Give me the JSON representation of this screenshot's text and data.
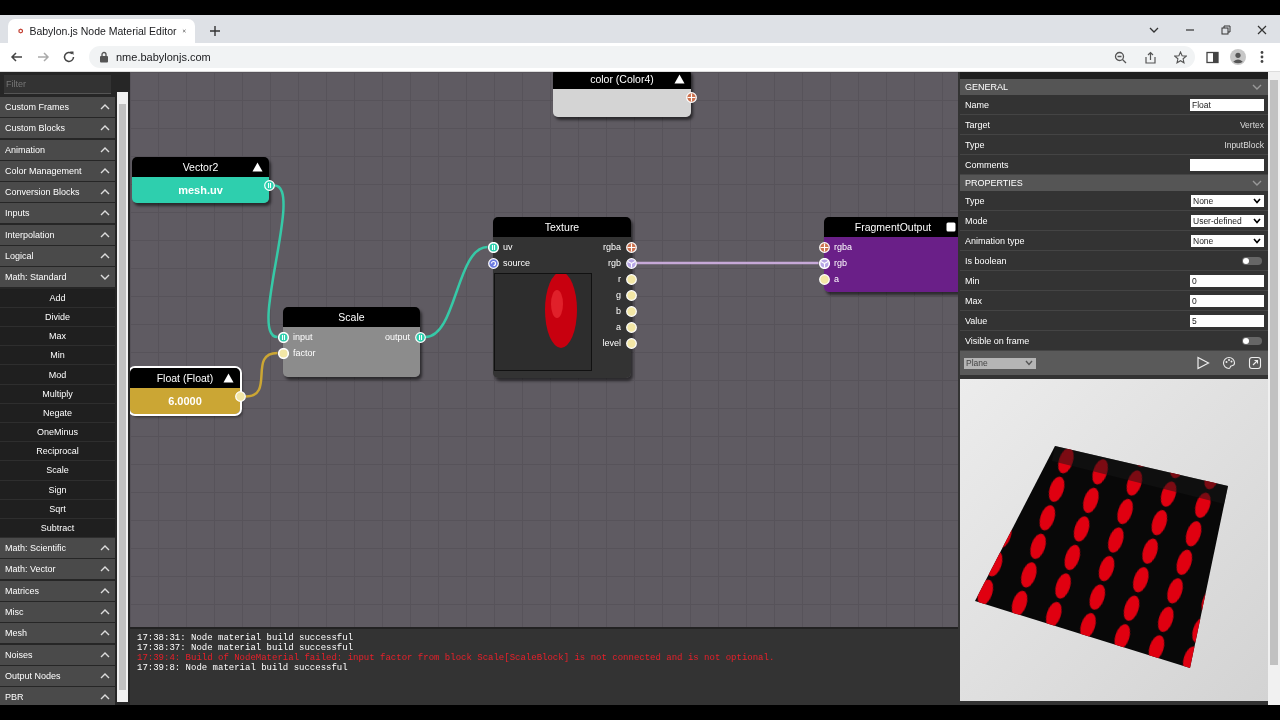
{
  "browser": {
    "tab_title": "Babylon.js Node Material Editor",
    "url": "nme.babylonjs.com"
  },
  "sidebar": {
    "filter_placeholder": "Filter",
    "categories": [
      {
        "label": "Custom Frames",
        "expanded": false
      },
      {
        "label": "Custom Blocks",
        "expanded": false
      },
      {
        "label": "Animation",
        "expanded": false
      },
      {
        "label": "Color Management",
        "expanded": false
      },
      {
        "label": "Conversion Blocks",
        "expanded": false
      },
      {
        "label": "Inputs",
        "expanded": false
      },
      {
        "label": "Interpolation",
        "expanded": false
      },
      {
        "label": "Logical",
        "expanded": false
      },
      {
        "label": "Math: Standard",
        "expanded": true,
        "children": [
          {
            "label": "Add"
          },
          {
            "label": "Divide"
          },
          {
            "label": "Max"
          },
          {
            "label": "Min"
          },
          {
            "label": "Mod"
          },
          {
            "label": "Multiply"
          },
          {
            "label": "Negate"
          },
          {
            "label": "OneMinus"
          },
          {
            "label": "Reciprocal"
          },
          {
            "label": "Scale"
          },
          {
            "label": "Sign"
          },
          {
            "label": "Sqrt"
          },
          {
            "label": "Subtract"
          }
        ]
      },
      {
        "label": "Math: Scientific",
        "expanded": false
      },
      {
        "label": "Math: Vector",
        "expanded": false
      },
      {
        "label": "Matrices",
        "expanded": false
      },
      {
        "label": "Misc",
        "expanded": false
      },
      {
        "label": "Mesh",
        "expanded": false
      },
      {
        "label": "Noises",
        "expanded": false
      },
      {
        "label": "Output Nodes",
        "expanded": false
      },
      {
        "label": "PBR",
        "expanded": false
      }
    ]
  },
  "graph": {
    "nodes": [
      {
        "title": "color (Color4)",
        "kind": "input",
        "selected": false,
        "color": "#d4d4d4",
        "outputs": [
          {
            "kind": "color4"
          }
        ]
      },
      {
        "title": "Vector2",
        "kind": "input",
        "selected": false,
        "color": "#2ecfae",
        "value": "mesh.uv",
        "outputs": [
          {
            "kind": "vector2"
          }
        ]
      },
      {
        "title": "Float (Float)",
        "kind": "input",
        "selected": true,
        "color": "#cba634",
        "value": "6.0000",
        "outputs": [
          {
            "kind": "float"
          }
        ]
      },
      {
        "title": "Scale",
        "kind": "block",
        "selected": false,
        "color": "#8c8c8c",
        "inputs": [
          {
            "label": "input",
            "kind": "vector2",
            "connected": true
          },
          {
            "label": "factor",
            "kind": "float",
            "connected": true
          }
        ],
        "outputs": [
          {
            "label": "output",
            "kind": "vector2"
          }
        ]
      },
      {
        "title": "Texture",
        "kind": "texture",
        "selected": false,
        "color": "#333333",
        "inputs": [
          {
            "label": "uv",
            "kind": "vector2",
            "connected": true
          },
          {
            "label": "source",
            "kind": "texture",
            "connected": false
          }
        ],
        "outputs": [
          {
            "label": "rgba",
            "kind": "color4"
          },
          {
            "label": "rgb",
            "kind": "color3"
          },
          {
            "label": "r",
            "kind": "float"
          },
          {
            "label": "g",
            "kind": "float"
          },
          {
            "label": "b",
            "kind": "float"
          },
          {
            "label": "a",
            "kind": "float"
          },
          {
            "label": "level",
            "kind": "float"
          }
        ]
      },
      {
        "title": "FragmentOutput",
        "kind": "output",
        "selected": false,
        "color": "#6a1f88",
        "inputs": [
          {
            "label": "rgba",
            "kind": "color4",
            "connected": false
          },
          {
            "label": "rgb",
            "kind": "color3",
            "connected": true
          },
          {
            "label": "a",
            "kind": "float",
            "connected": false
          }
        ]
      }
    ]
  },
  "log": [
    {
      "text": "17:38:31: Node material build successful",
      "kind": "info"
    },
    {
      "text": "17:38:37: Node material build successful",
      "kind": "info"
    },
    {
      "text": "17:39:4: Build of NodeMaterial failed: input factor from block Scale[ScaleBlock] is not connected and is not optional.",
      "kind": "error"
    },
    {
      "text": "17:39:8: Node material build successful",
      "kind": "info"
    }
  ],
  "properties": {
    "sections": [
      {
        "title": "GENERAL",
        "expanded": true,
        "rows": [
          {
            "label": "Name",
            "kind": "input",
            "value": "Float"
          },
          {
            "label": "Target",
            "kind": "text",
            "value": "Vertex"
          },
          {
            "label": "Type",
            "kind": "text",
            "value": "InputBlock"
          },
          {
            "label": "Comments",
            "kind": "input"
          }
        ]
      },
      {
        "title": "PROPERTIES",
        "expanded": true,
        "rows": [
          {
            "label": "Type",
            "kind": "select",
            "value": "None"
          },
          {
            "label": "Mode",
            "kind": "select",
            "value": "User-defined"
          },
          {
            "label": "Animation type",
            "kind": "select",
            "value": "None"
          },
          {
            "label": "Is boolean",
            "kind": "toggle",
            "on": false
          },
          {
            "label": "Min",
            "kind": "input",
            "value": "0"
          },
          {
            "label": "Max",
            "kind": "input",
            "value": "0"
          },
          {
            "label": "Value",
            "kind": "input",
            "value": "5"
          },
          {
            "label": "Visible on frame",
            "kind": "toggle",
            "on": false
          }
        ]
      }
    ],
    "preview": {
      "mesh": "Plane"
    }
  }
}
